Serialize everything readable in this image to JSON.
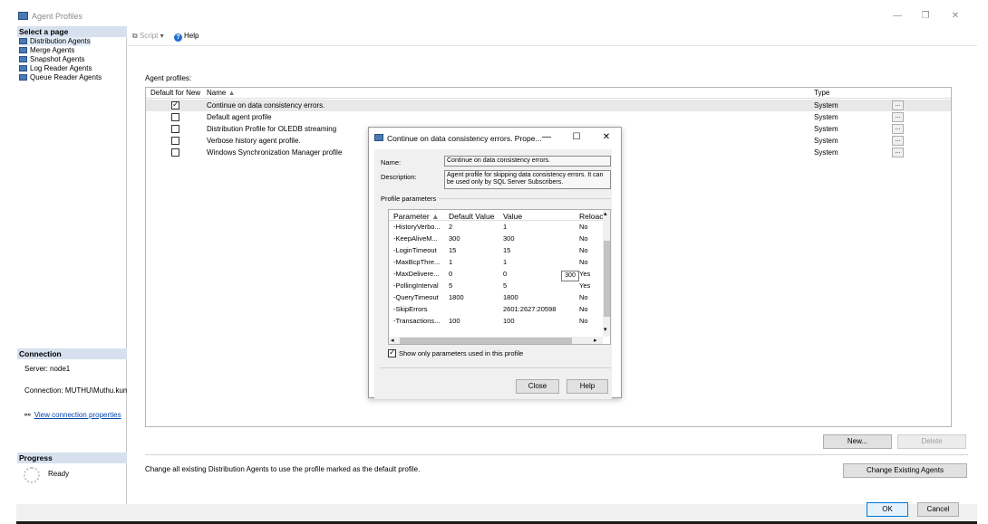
{
  "window": {
    "title": "Agent Profiles",
    "controls": {
      "minimize": "—",
      "maximize": "❐",
      "close": "✕"
    }
  },
  "left": {
    "select_page_header": "Select a page",
    "pages": [
      {
        "label": "Distribution Agents"
      },
      {
        "label": "Merge Agents"
      },
      {
        "label": "Snapshot Agents"
      },
      {
        "label": "Log Reader Agents"
      },
      {
        "label": "Queue Reader Agents"
      }
    ],
    "connection_header": "Connection",
    "server": "Server: node1",
    "connection": "Connection: MUTHU\\Muthu.kuma",
    "view_connection": "View connection properties",
    "progress_header": "Progress",
    "progress_status": "Ready"
  },
  "toolbar": {
    "script_label": "Script",
    "help_label": "Help"
  },
  "main": {
    "agent_profiles_label": "Agent profiles:",
    "columns": {
      "default_for_new": "Default for New",
      "name": "Name",
      "type": "Type"
    },
    "rows": [
      {
        "default": true,
        "name": "Continue on data consistency errors.",
        "type": "System"
      },
      {
        "default": false,
        "name": "Default agent profile",
        "type": "System"
      },
      {
        "default": false,
        "name": "Distribution Profile for OLEDB streaming",
        "type": "System"
      },
      {
        "default": false,
        "name": "Verbose history agent profile.",
        "type": "System"
      },
      {
        "default": false,
        "name": "Windows Synchronization Manager profile",
        "type": "System"
      }
    ],
    "ellipsis": "...",
    "new_button": "New...",
    "delete_button": "Delete",
    "change_text": "Change all existing Distribution Agents to use the profile marked as the default profile.",
    "change_button": "Change Existing Agents"
  },
  "footer": {
    "ok": "OK",
    "cancel": "Cancel"
  },
  "dialog": {
    "title": "Continue on data consistency errors. Prope...",
    "controls": {
      "minimize": "—",
      "maximize": "☐",
      "close": "✕"
    },
    "name_label": "Name:",
    "name_value": "Continue on data consistency errors.",
    "description_label": "Description:",
    "description_value": "Agent profile for skipping data consistency errors. It can be used only by SQL Server Subscribers.",
    "profile_parameters_label": "Profile parameters",
    "param_columns": {
      "parameter": "Parameter",
      "default_value": "Default Value",
      "value": "Value",
      "reload": "Reloac"
    },
    "params": [
      {
        "parameter": "-HistoryVerbo...",
        "default": "2",
        "value": "1",
        "reload": "No"
      },
      {
        "parameter": "-KeepAliveM...",
        "default": "300",
        "value": "300",
        "reload": "No"
      },
      {
        "parameter": "-LoginTimeout",
        "default": "15",
        "value": "15",
        "reload": "No"
      },
      {
        "parameter": "-MaxBcpThre...",
        "default": "1",
        "value": "1",
        "reload": "No"
      },
      {
        "parameter": "-MaxDelivere...",
        "default": "0",
        "value": "0",
        "reload": "Yes"
      },
      {
        "parameter": "-PollingInterval",
        "default": "5",
        "value": "5",
        "reload": "Yes"
      },
      {
        "parameter": "-QueryTimeout",
        "default": "1800",
        "value": "1800",
        "reload": "No"
      },
      {
        "parameter": "-SkipErrors",
        "default": "",
        "value": "2601:2627:20598",
        "reload": "No"
      },
      {
        "parameter": "-Transactions...",
        "default": "100",
        "value": "100",
        "reload": "No"
      }
    ],
    "tooltip": "300",
    "show_only_label": "Show only parameters used in this profile",
    "close_button": "Close",
    "help_button": "Help"
  }
}
